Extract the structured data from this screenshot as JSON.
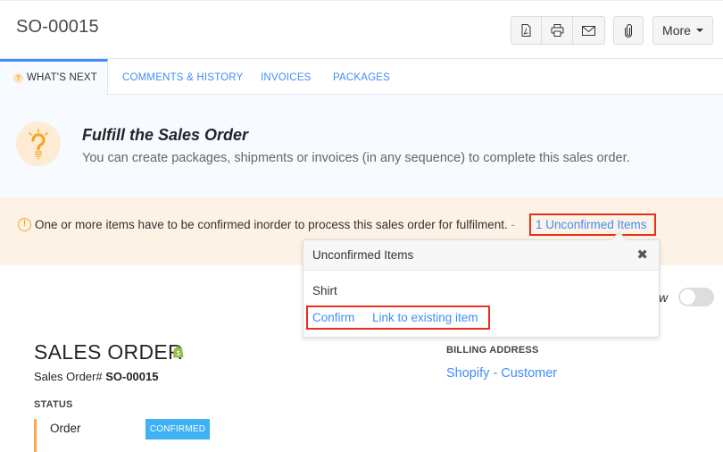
{
  "header": {
    "title": "SO-00015",
    "toolbar": {
      "icons": [
        "pdf-icon",
        "print-icon",
        "email-icon",
        "attachment-icon"
      ],
      "more_label": "More"
    }
  },
  "tabs": [
    {
      "label": "WHAT'S NEXT",
      "active": true,
      "badge": "?"
    },
    {
      "label": "COMMENTS & HISTORY",
      "active": false
    },
    {
      "label": "INVOICES",
      "active": false
    },
    {
      "label": "PACKAGES",
      "active": false
    }
  ],
  "whats_next": {
    "title": "Fulfill the Sales Order",
    "description": "You can create packages, shipments or invoices (in any sequence) to complete this sales order."
  },
  "warning": {
    "icon": "!",
    "message": "One or more items have to be confirmed inorder to process this sales order for fulfilment.",
    "separator": "-",
    "link_label": "1 Unconfirmed Items"
  },
  "popover": {
    "title": "Unconfirmed Items",
    "close_glyph": "✖",
    "item": "Shirt",
    "actions": {
      "confirm": "Confirm",
      "link_existing": "Link to existing item"
    }
  },
  "view_toggle": {
    "label_visible": "w",
    "enabled": false
  },
  "document": {
    "heading": "SALES ORDER",
    "number_label": "Sales Order#",
    "number_value": "SO-00015",
    "status_heading": "STATUS",
    "status_key": "Order",
    "status_value": "CONFIRMED",
    "billing_heading": "BILLING ADDRESS",
    "billing_name": "Shopify - Customer"
  },
  "colors": {
    "accent": "#408dfb",
    "badge": "#3fb1f4",
    "warning": "#f5a623",
    "highlight": "#e8301c",
    "shopify": "#95bf47"
  }
}
